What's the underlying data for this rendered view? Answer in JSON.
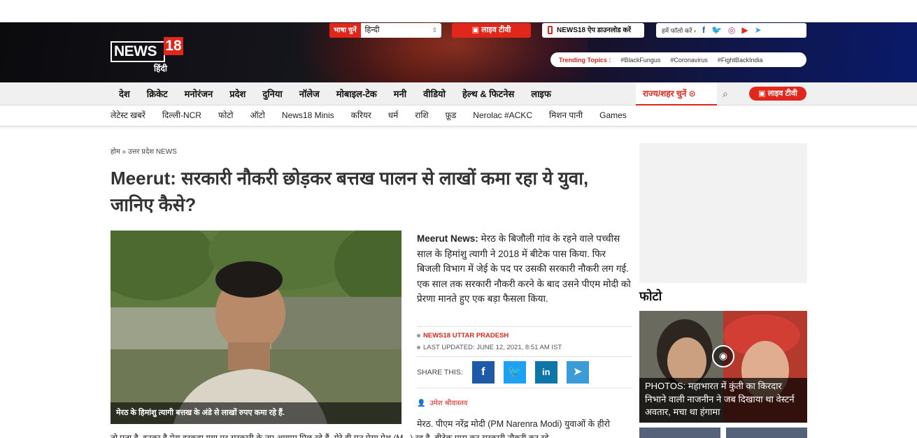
{
  "header": {
    "logo_text": "NEWS",
    "logo_num": "18",
    "logo_sub": "हिंदी",
    "lang_label": "भाषा चुनें",
    "lang_value": "हिन्दी",
    "live_tv": "लाइव टीवी",
    "app_download": "NEWS18 ऐप डाउनलोड करें",
    "follow_label": "हमें फॉलो करें",
    "trending_label": "Trending Topics :",
    "trending": [
      "#BlackFungus",
      "#Coronavirus",
      "#FightBackIndia"
    ]
  },
  "nav_primary": {
    "items": [
      "देश",
      "क्रिकेट",
      "मनोरंजन",
      "प्रदेश",
      "दुनिया",
      "नॉलेज",
      "मोबाइल-टेक",
      "मनी",
      "वीडियो",
      "हेल्थ & फिटनेस",
      "लाइफ"
    ],
    "state_select": "राज्य/शहर चुनें",
    "live_tv": "लाइव टीवी"
  },
  "nav_secondary": {
    "items": [
      "लेटेस्ट खबरें",
      "दिल्ली-NCR",
      "फोटो",
      "ऑटो",
      "News18 Minis",
      "करियर",
      "धर्म",
      "राशि",
      "फ़ूड",
      "Nerolac #ACKC",
      "मिशन पानी",
      "Games"
    ]
  },
  "article": {
    "breadcrumb": "होम » उत्तर प्रदेश NEWS",
    "title": "Meerut: सरकारी नौकरी छोड़कर बत्तख पालन से लाखों कमा रहा ये युवा, जानिए कैसे?",
    "photo_caption": "मेरठ के हिमांशु त्यागी बत्तख के अंडे से लाखों रुपए कमा रहे हैं.",
    "lede_bold": "Meerut News:",
    "lede": " मेरठ के बिजौली गांव के रहने वाले पच्चीस साल के हिमांशु त्यागी ने 2018 में बीटेक पास किया. फिर बिजली विभाग में जेई के पद पर उसकी सरकारी नौकरी लग गई. एक साल तक सरकारी नौकरी करने के बाद उसने पीएम मोदी को प्रेरणा मानते हुए एक बड़ा फैसला किया.",
    "source": "NEWS18 UTTAR PRADESH",
    "updated": "LAST UPDATED: JUNE 12, 2021, 8:51 AM IST",
    "share_label": "SHARE THIS:",
    "author": "उमेश श्रीवास्तव",
    "body_line": "मेरठ. पीएम नरेंद्र मोदी (PM Narenra Modi) युवाओं के हीरो",
    "body_line2": "तो पता है. इनका है मेरा हरकहा गया पर सरकारी के नए आयाम पिछ रहे हैं. मेरे ही मन ऐसा पेश (M...) रह है. बीटेक पास कर सरकारी नौकरी कर रहे"
  },
  "sidebar": {
    "photos_heading": "फोटो",
    "gallery_caption": "PHOTOS: महाभारत में कुंती का किरदार निभाने वाली नाजनीन ने जब दिखाया था वेस्टर्न अवतार, मचा था हंगामा"
  },
  "colors": {
    "brand_red": "#e1261c",
    "facebook": "#1f5aa8",
    "twitter": "#1da1f2",
    "linkedin": "#0e76a8",
    "telegram": "#3b9bd6"
  }
}
